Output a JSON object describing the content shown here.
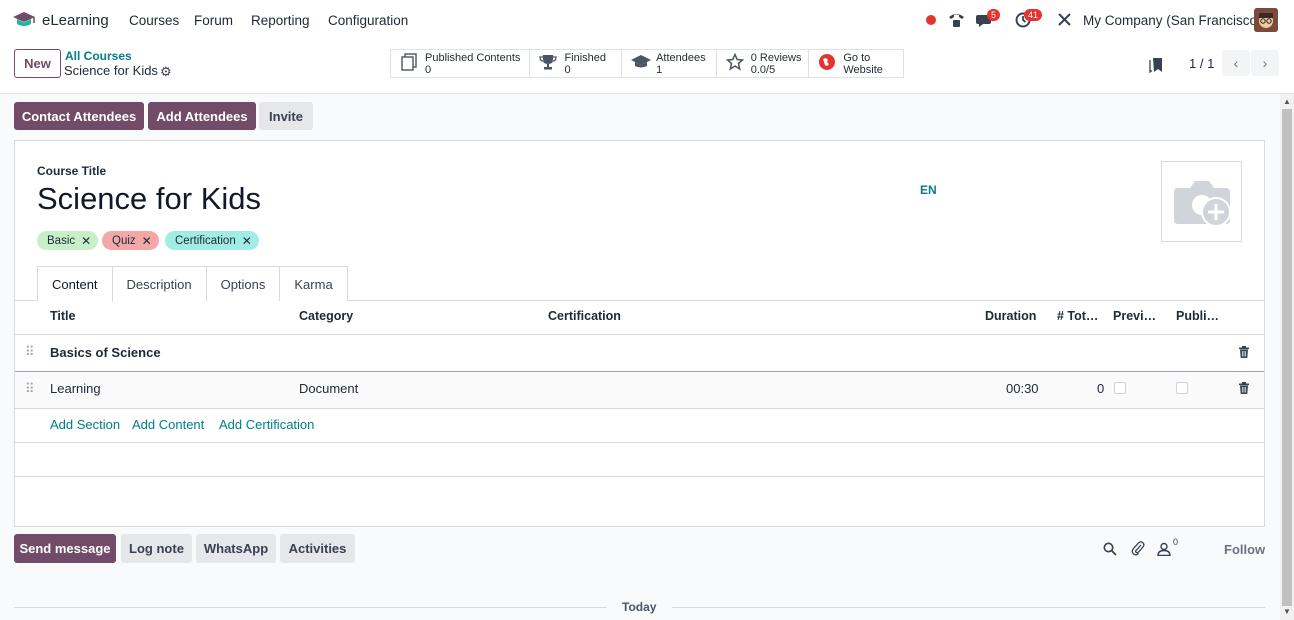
{
  "nav": {
    "app_name": "eLearning",
    "menu": [
      "Courses",
      "Forum",
      "Reporting",
      "Configuration"
    ],
    "chat_badge": "5",
    "activity_badge": "41",
    "company": "My Company (San Francisco)"
  },
  "control": {
    "new_label": "New",
    "breadcrumb_parent": "All Courses",
    "breadcrumb_current": "Science for Kids",
    "stats": [
      {
        "label": "Published Contents",
        "value": "0",
        "icon": "documents-icon"
      },
      {
        "label": "Finished",
        "value": "0",
        "icon": "trophy-icon"
      },
      {
        "label": "Attendees",
        "value": "1",
        "icon": "graduation-cap-icon"
      },
      {
        "label": "0 Reviews",
        "value": "0.0/5",
        "icon": "star-icon"
      },
      {
        "label": "Go to",
        "value": "Website",
        "icon": "globe-icon"
      }
    ],
    "pager": "1 / 1"
  },
  "actions": {
    "contact": "Contact Attendees",
    "add": "Add Attendees",
    "invite": "Invite"
  },
  "form": {
    "title_label": "Course Title",
    "title": "Science for Kids",
    "lang": "EN",
    "tags": [
      {
        "label": "Basic",
        "color": "#c7efc8"
      },
      {
        "label": "Quiz",
        "color": "#f3a7a7"
      },
      {
        "label": "Certification",
        "color": "#a1ece4"
      }
    ],
    "tabs": [
      "Content",
      "Description",
      "Options",
      "Karma"
    ],
    "columns": {
      "title": "Title",
      "category": "Category",
      "certification": "Certification",
      "duration": "Duration",
      "total": "# Tot…",
      "preview": "Previ…",
      "published": "Publi…"
    },
    "section_name": "Basics of Science",
    "rows": [
      {
        "title": "Learning",
        "category": "Document",
        "duration": "00:30",
        "total": "0"
      }
    ],
    "add_links": [
      "Add Section",
      "Add Content",
      "Add Certification"
    ]
  },
  "chatter": {
    "send": "Send message",
    "log": "Log note",
    "whatsapp": "WhatsApp",
    "activities": "Activities",
    "followers": "0",
    "follow": "Follow",
    "today": "Today"
  },
  "colors": {
    "brand": "#714b67",
    "link": "#017e84"
  }
}
